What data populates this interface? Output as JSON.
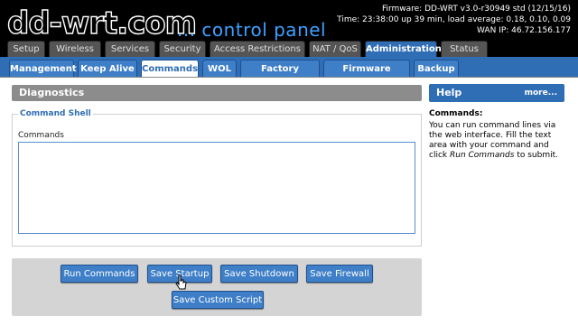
{
  "header": {
    "logo_main": "dd-wrt.com",
    "logo_sub": "... control panel",
    "firmware": "Firmware: DD-WRT v3.0-r30949 std (12/15/16)",
    "time": "Time: 23:38:00 up 39 min, load average: 0.18, 0.10, 0.09",
    "wan_ip": "WAN IP: 46.72.156.177"
  },
  "main_tabs": [
    "Setup",
    "Wireless",
    "Services",
    "Security",
    "Access Restrictions",
    "NAT / QoS",
    "Administration",
    "Status"
  ],
  "active_main_tab": "Administration",
  "sub_tabs": [
    "Management",
    "Keep Alive",
    "Commands",
    "WOL",
    "Factory Defaults",
    "Firmware Upgrade",
    "Backup"
  ],
  "active_sub_tab": "Commands",
  "diagnostics": {
    "title": "Diagnostics",
    "legend": "Command Shell",
    "commands_label": "Commands",
    "commands_value": ""
  },
  "buttons": {
    "run_commands": "Run Commands",
    "save_startup": "Save Startup",
    "save_shutdown": "Save Shutdown",
    "save_firewall": "Save Firewall",
    "save_custom_script": "Save Custom Script"
  },
  "help": {
    "title": "Help",
    "more": "more...",
    "heading": "Commands:",
    "text_1": "You can run command lines via the web interface. Fill the text area with your command and click ",
    "text_em": "Run Commands",
    "text_2": " to submit."
  },
  "colors": {
    "accent": "#2f6db5",
    "header_bg": "#000000",
    "panel_gray": "#8c8c8c"
  }
}
